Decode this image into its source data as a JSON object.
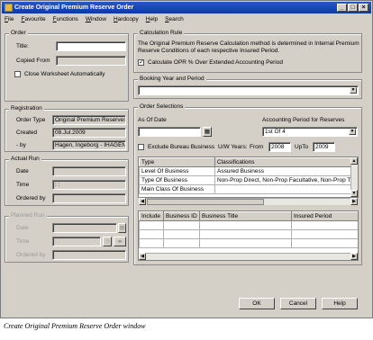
{
  "title": "Create Original Premium Reserve Order",
  "menu": [
    "File",
    "Favourite",
    "Functions",
    "Window",
    "Hardcopy",
    "Help",
    "Search"
  ],
  "order": {
    "legend": "Order",
    "title_label": "Title:",
    "title_value": "",
    "copied_label": "Copied From",
    "copied_value": "",
    "close_label": "Close Worksheet Automatically"
  },
  "calc": {
    "legend": "Calculation Rule",
    "text": "The Original Premium Reserve Calculation method is determined in Internal Premium Reserve Conditions of each respective Insured Period.",
    "check_label": "Calculate OPR % Over Extended Accounting Period"
  },
  "booking": {
    "legend": "Booking Year and Period",
    "value": ""
  },
  "registration": {
    "legend": "Registration",
    "type_label": "Order Type",
    "type_value": "Original Premium Reserves",
    "created_label": "Created",
    "created_value": "08.Jul.2009",
    "by_label": "- by",
    "by_value": "Hagen, Ingeborg - IHAGEN"
  },
  "actual": {
    "legend": "Actual Run",
    "date_label": "Date",
    "time_label": "Time",
    "time_value": ": :",
    "ordered_label": "Ordered by"
  },
  "planned": {
    "legend": "Planned Run",
    "date_label": "Date",
    "time_label": "Time",
    "time_value": ": :",
    "ordered_label": "Ordered by"
  },
  "selections": {
    "legend": "Order Selections",
    "asof_label": "As Of Date",
    "asof_value": "",
    "acct_label": "Accounting Period for Reserves",
    "acct_value": "1st Of 4",
    "exclude_label": "Exclude Bureau Business",
    "uw_label": "U/W Years:",
    "from_label": "From",
    "from_value": "2008",
    "upto_label": "UpTo",
    "upto_value": "2009",
    "class_headers": [
      "Type",
      "Classifications"
    ],
    "class_rows": [
      [
        "Level Of Business",
        "Assured Business"
      ],
      [
        "Type Of Business",
        "Non-Prop Direct, Non-Prop Facultative, Non-Prop Trea"
      ],
      [
        "Main Class Of Business",
        ""
      ]
    ],
    "period_headers": [
      "Include",
      "Business ID",
      "Business Title",
      "Insured Period"
    ]
  },
  "buttons": {
    "ok": "OK",
    "cancel": "Cancel",
    "help": "Help"
  },
  "caption": "Create Original Premium Reserve Order window"
}
